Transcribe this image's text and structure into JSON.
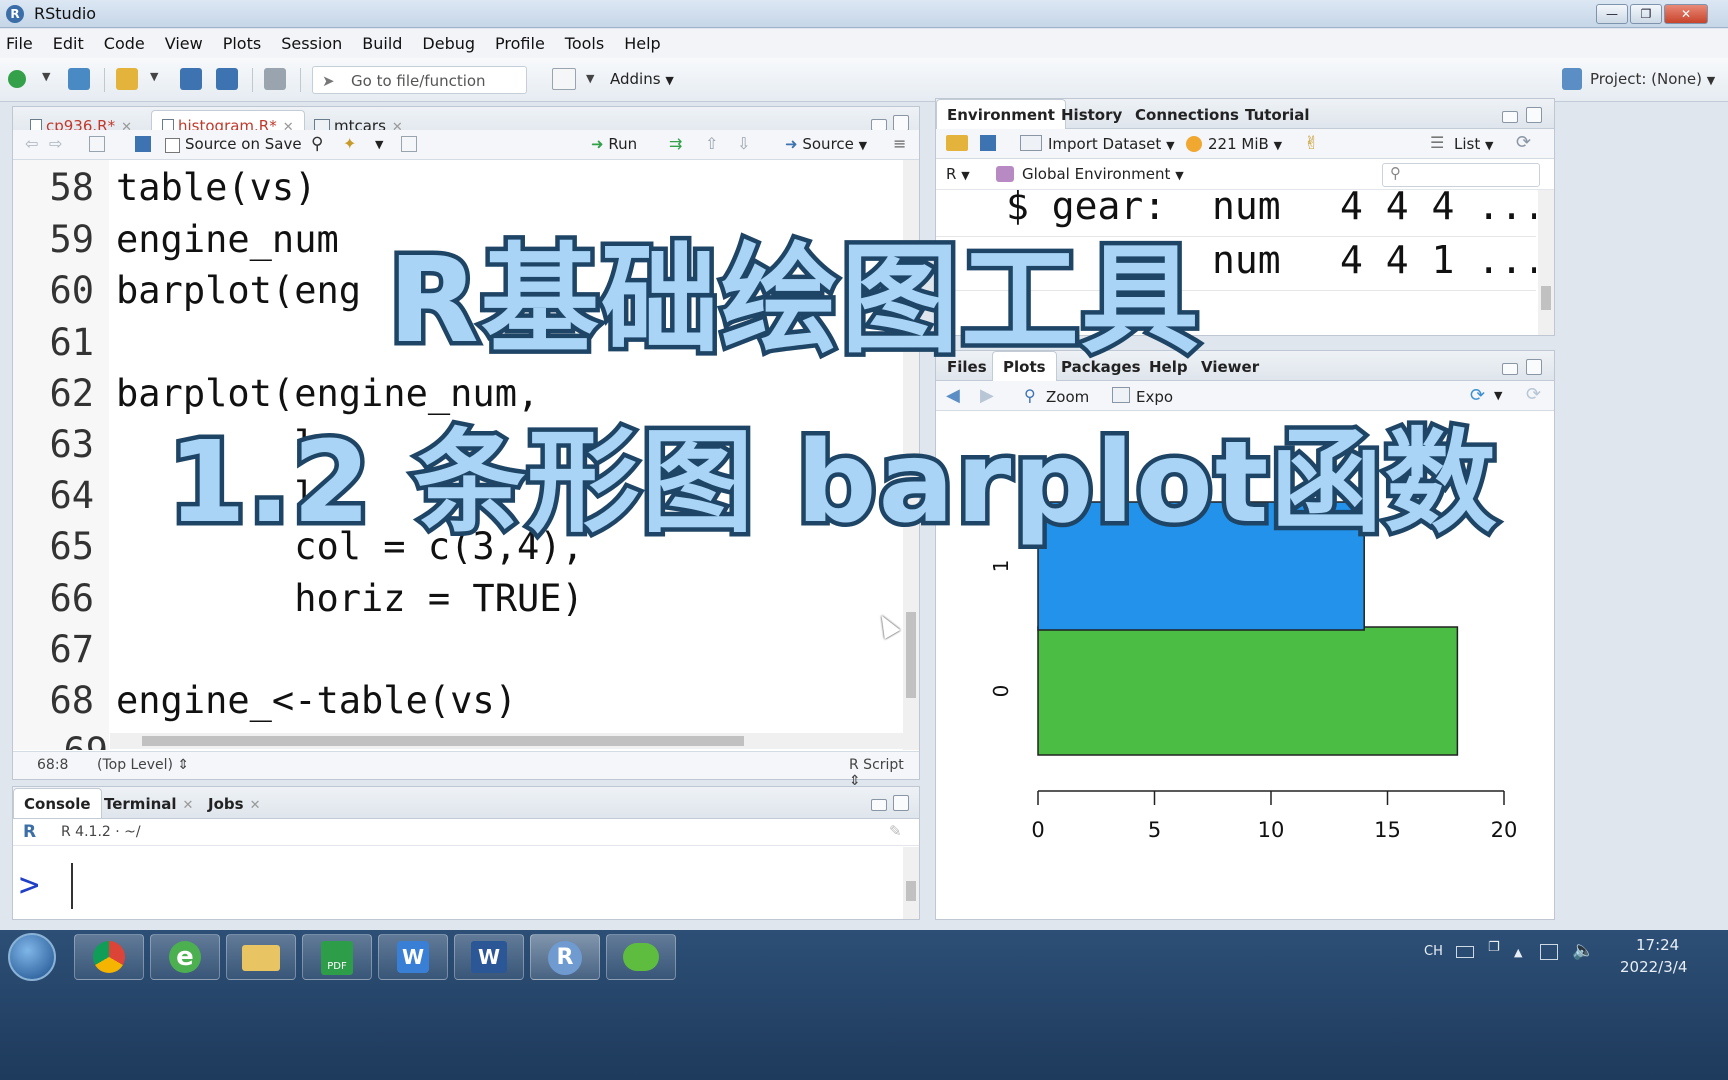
{
  "window": {
    "title": "RStudio",
    "app_icon": "R"
  },
  "menubar": [
    "File",
    "Edit",
    "Code",
    "View",
    "Plots",
    "Session",
    "Build",
    "Debug",
    "Profile",
    "Tools",
    "Help"
  ],
  "toolbar": {
    "goto_placeholder": "Go to file/function",
    "addins_label": "Addins",
    "project_label": "Project: (None)"
  },
  "editor": {
    "tabs": [
      {
        "label": "cp936.R*",
        "color": "#c0392b"
      },
      {
        "label": "histogram.R*",
        "color": "#c0392b"
      },
      {
        "label": "mtcars",
        "color": "#222222"
      }
    ],
    "source_on_save_label": "Source on Save",
    "run_label": "Run",
    "source_label": "Source",
    "lines": [
      {
        "no": "58",
        "code": "table(vs)"
      },
      {
        "no": "59",
        "code": "engine_num"
      },
      {
        "no": "60",
        "code": "barplot(eng"
      },
      {
        "no": "61",
        "code": ""
      },
      {
        "no": "62",
        "code": "barplot(engine_num,"
      },
      {
        "no": "63",
        "code": "        l"
      },
      {
        "no": "64",
        "code": "        l"
      },
      {
        "no": "65",
        "code": "        col = c(3,4),"
      },
      {
        "no": "66",
        "code": "        horiz = TRUE)"
      },
      {
        "no": "67",
        "code": ""
      },
      {
        "no": "68",
        "code": "engine_<-table(vs)"
      },
      {
        "no": "69",
        "code": ""
      }
    ],
    "status_position": "68:8",
    "status_scope": "(Top Level)",
    "status_filetype": "R Script"
  },
  "console": {
    "tabs": [
      "Console",
      "Terminal",
      "Jobs"
    ],
    "r_version": "R 4.1.2 · ~/",
    "prompt": ">"
  },
  "environment": {
    "tabs": [
      "Environment",
      "History",
      "Connections",
      "Tutorial"
    ],
    "import_label": "Import Dataset",
    "memory_label": "221 MiB",
    "list_label": "List",
    "r_label": "R",
    "scope_label": "Global Environment",
    "rows": [
      {
        "name": "$ gear:",
        "type": "num",
        "values": "4 4 4 ..."
      },
      {
        "name": "$",
        "type": "num",
        "values": "4 4 1 ..."
      }
    ]
  },
  "files_pane": {
    "tabs": [
      "Files",
      "Plots",
      "Packages",
      "Help",
      "Viewer"
    ],
    "zoom_label": "Zoom",
    "export_label": "Expo"
  },
  "chart_data": {
    "type": "bar",
    "orientation": "horizontal",
    "categories": [
      "0",
      "1"
    ],
    "values": [
      18,
      14
    ],
    "colors": [
      "#4bbd45",
      "#2292ea"
    ],
    "xlim": [
      0,
      20
    ],
    "xticks": [
      "0",
      "5",
      "10",
      "15",
      "20"
    ]
  },
  "overlay": {
    "line1": "R基础绘图工具",
    "line2": "1.2 条形图 barplot函数"
  },
  "taskbar": {
    "apps": [
      "start",
      "chrome",
      "ie",
      "explorer",
      "pdf",
      "wps",
      "word",
      "rstudio",
      "wechat"
    ],
    "lang": "CH",
    "time": "17:24",
    "date": "2022/3/4"
  }
}
